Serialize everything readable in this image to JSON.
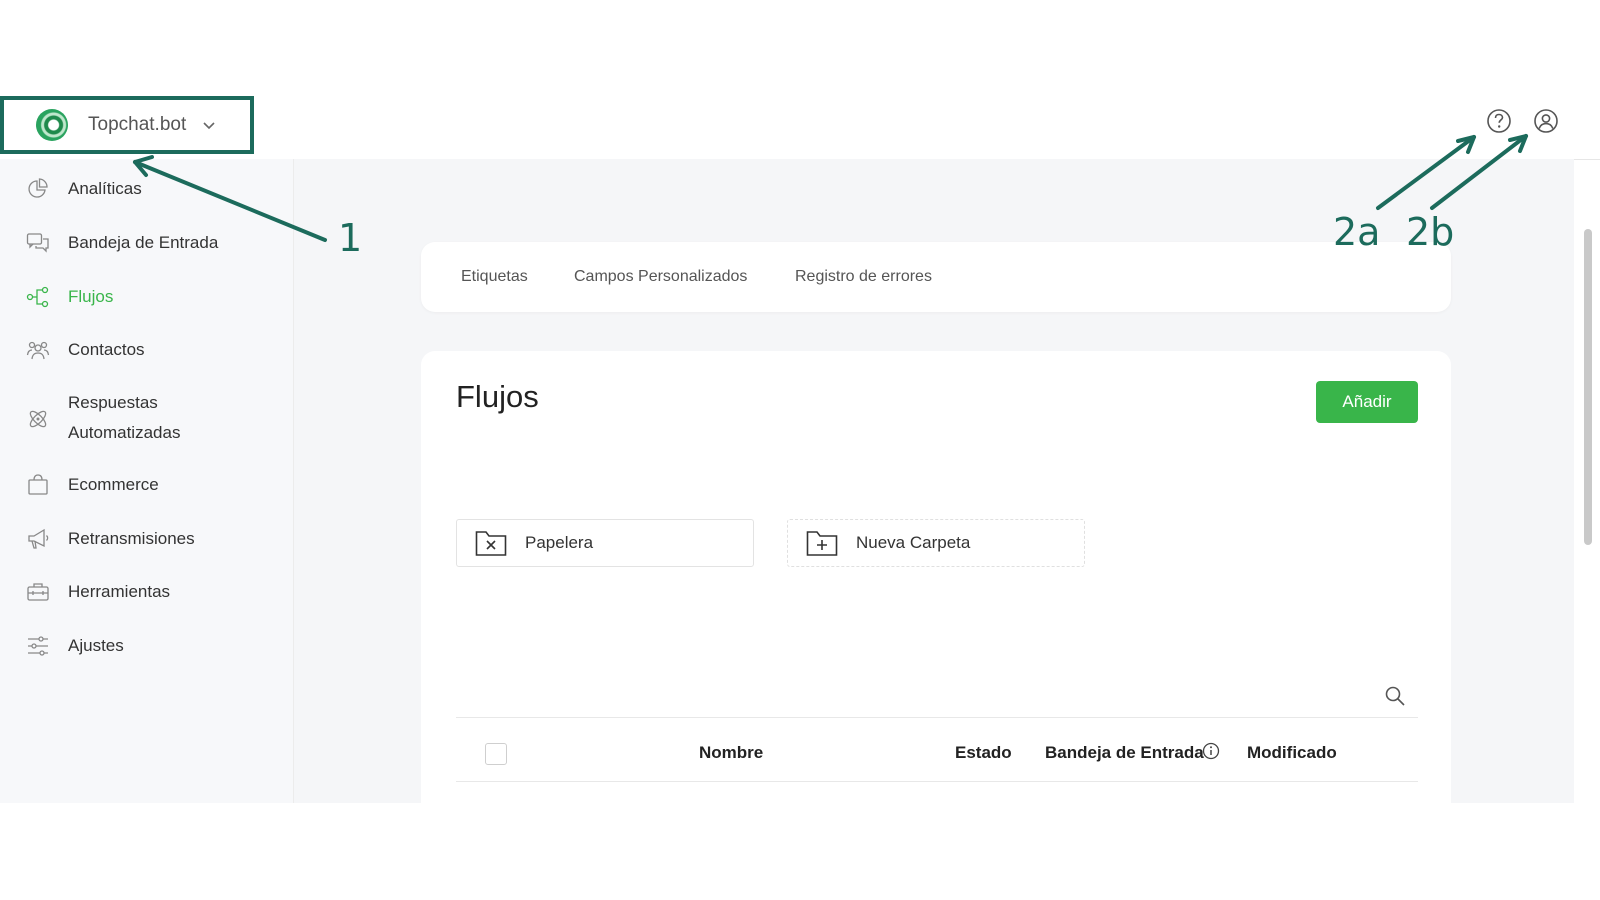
{
  "header": {
    "brand_name": "Topchat.bot",
    "help_icon": "help-circle-icon",
    "account_icon": "user-circle-icon"
  },
  "sidebar": {
    "items": [
      {
        "label": "Analíticas",
        "icon": "pie-chart-icon"
      },
      {
        "label": "Bandeja de Entrada",
        "icon": "chat-bubbles-icon"
      },
      {
        "label": "Flujos",
        "icon": "flow-nodes-icon",
        "active": true
      },
      {
        "label": "Contactos",
        "icon": "people-icon"
      },
      {
        "label": "Respuestas",
        "label2": "Automatizadas",
        "icon": "atom-icon"
      },
      {
        "label": "Ecommerce",
        "icon": "shopping-bag-icon"
      },
      {
        "label": "Retransmisiones",
        "icon": "megaphone-icon"
      },
      {
        "label": "Herramientas",
        "icon": "toolbox-icon"
      },
      {
        "label": "Ajustes",
        "icon": "sliders-icon"
      }
    ]
  },
  "tabs": [
    "Etiquetas",
    "Campos Personalizados",
    "Registro de errores"
  ],
  "flows": {
    "title": "Flujos",
    "add_label": "Añadir",
    "folders": [
      {
        "label": "Papelera",
        "icon": "folder-x-icon"
      },
      {
        "label": "Nueva Carpeta",
        "icon": "folder-plus-icon"
      }
    ],
    "table": {
      "columns": [
        "Nombre",
        "Estado",
        "Bandeja de Entrada",
        "Modificado"
      ]
    }
  },
  "annotations": [
    "1",
    "2a",
    "2b"
  ],
  "colors": {
    "accent": "#39b54a",
    "annotation": "#1c6b5c",
    "sidebar_bg": "#f7f8fa",
    "main_bg": "#f5f6f8"
  }
}
